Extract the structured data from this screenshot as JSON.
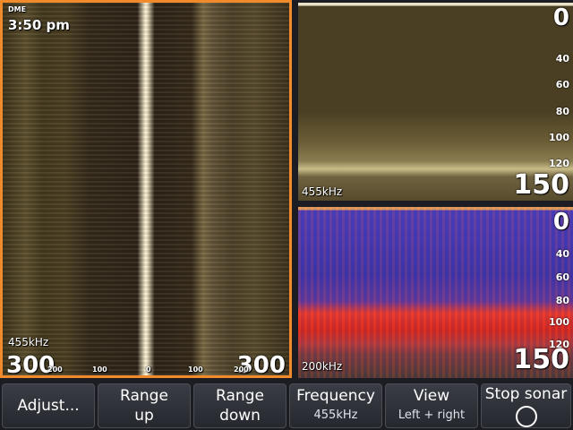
{
  "sidescan": {
    "tag": "DME",
    "time": "3:50 pm",
    "frequency": "455kHz",
    "range_left": "300",
    "range_right": "300",
    "ticks": [
      "200",
      "100",
      "0",
      "100",
      "200"
    ]
  },
  "downscan_top": {
    "depth_top": "0",
    "depth_bottom": "150",
    "frequency": "455kHz",
    "scale": [
      "40",
      "60",
      "80",
      "100",
      "120"
    ]
  },
  "downscan_bottom": {
    "depth_top": "0",
    "depth_bottom": "150",
    "frequency": "200kHz",
    "scale": [
      "40",
      "60",
      "80",
      "100",
      "120"
    ]
  },
  "toolbar": {
    "adjust": "Adjust...",
    "range_up_1": "Range",
    "range_up_2": "up",
    "range_down_1": "Range",
    "range_down_2": "down",
    "frequency_label": "Frequency",
    "frequency_value": "455kHz",
    "view_label": "View",
    "view_value": "Left + right",
    "stop_label": "Stop sonar"
  }
}
